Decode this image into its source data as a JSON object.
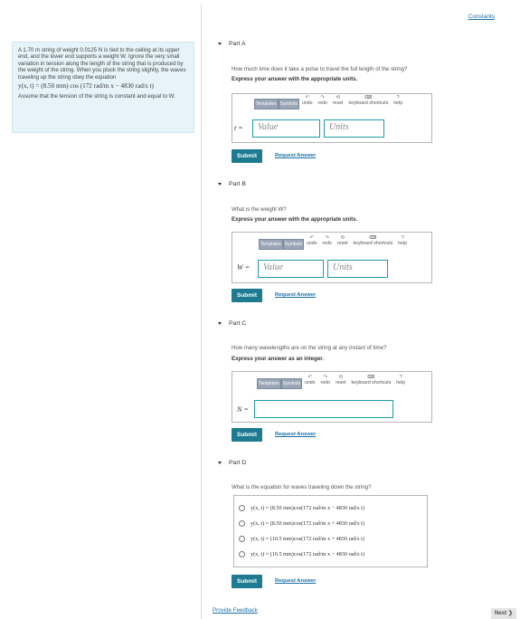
{
  "header": {
    "constants_link": "Constants"
  },
  "problem": {
    "text": "A 1.70 m string of weight 0.0125 N is tied to the ceiling at its upper end, and the lower end supports a weight W. Ignore the very small variation in tension along the length of the string that is produced by the weight of the string. When you pluck the string slightly, the waves traveling up the string obey the equation",
    "equation": "y(x, t) = (8.50 mm) cos (172 rad/m x − 4830 rad/s t)",
    "assumption": "Assume that the tension of the string is constant and equal to W."
  },
  "toolbar": {
    "templates": "Templates",
    "symbols": "Symbols",
    "undo": "undo",
    "redo": "redo",
    "reset": "reset",
    "keyboard": "keyboard shortcuts",
    "help": "help"
  },
  "parts": {
    "a": {
      "title": "Part A",
      "question": "How much time does it take a pulse to travel the full length of the string?",
      "instruction": "Express your answer with the appropriate units.",
      "variable": "t =",
      "value_placeholder": "Value",
      "units_placeholder": "Units",
      "submit": "Submit",
      "request": "Request Answer"
    },
    "b": {
      "title": "Part B",
      "question": "What is the weight W?",
      "instruction": "Express your answer with the appropriate units.",
      "variable": "W =",
      "value_placeholder": "Value",
      "units_placeholder": "Units",
      "submit": "Submit",
      "request": "Request Answer"
    },
    "c": {
      "title": "Part C",
      "question": "How many wavelengths are on the string at any instant of time?",
      "instruction": "Express your answer as an integer.",
      "variable": "N =",
      "submit": "Submit",
      "request": "Request Answer"
    },
    "d": {
      "title": "Part D",
      "question": "What is the equation for waves traveling down the string?",
      "options": [
        "y(x, t) = (8.50 mm)cos(172 rad/m x − 4830 rad/s t)",
        "y(x, t) = (8.50 mm)cos(172 rad/m x + 4830 rad/s t)",
        "y(x, t) = (10.5 mm)cos(172 rad/m x + 4830 rad/s t)",
        "y(x, t) = (10.5 mm)cos(172 rad/m x − 4830 rad/s t)"
      ],
      "submit": "Submit",
      "request": "Request Answer"
    }
  },
  "footer": {
    "feedback": "Provide Feedback",
    "next": "Next ❯"
  }
}
